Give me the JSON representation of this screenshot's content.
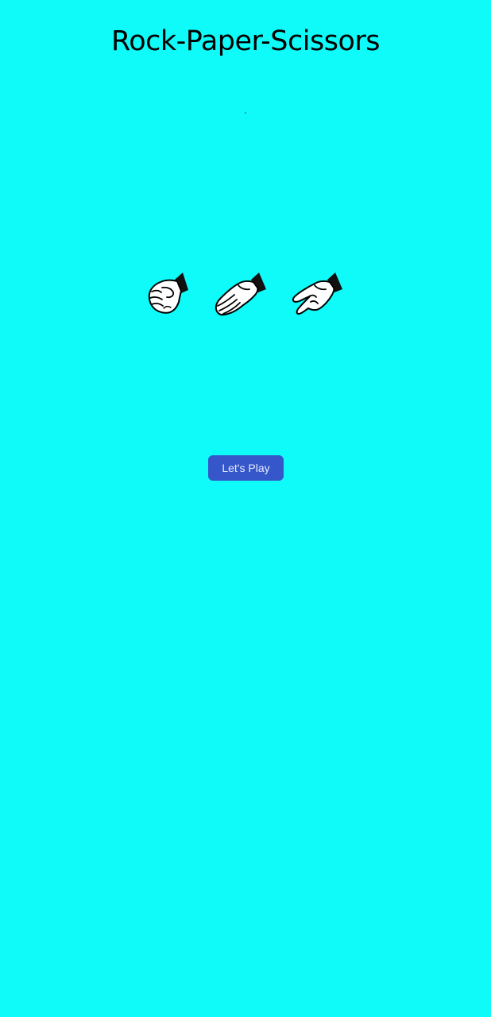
{
  "app": {
    "title": "Rock-Paper-Scissors"
  },
  "choices": [
    {
      "id": "rock",
      "icon": "rock-hand-icon"
    },
    {
      "id": "paper",
      "icon": "paper-hand-icon"
    },
    {
      "id": "scissors",
      "icon": "scissors-hand-icon"
    }
  ],
  "actions": {
    "play_label": "Let's Play"
  },
  "colors": {
    "background": "#0ffbf9",
    "button": "#3557c9",
    "button_text": "#e6ecff"
  }
}
